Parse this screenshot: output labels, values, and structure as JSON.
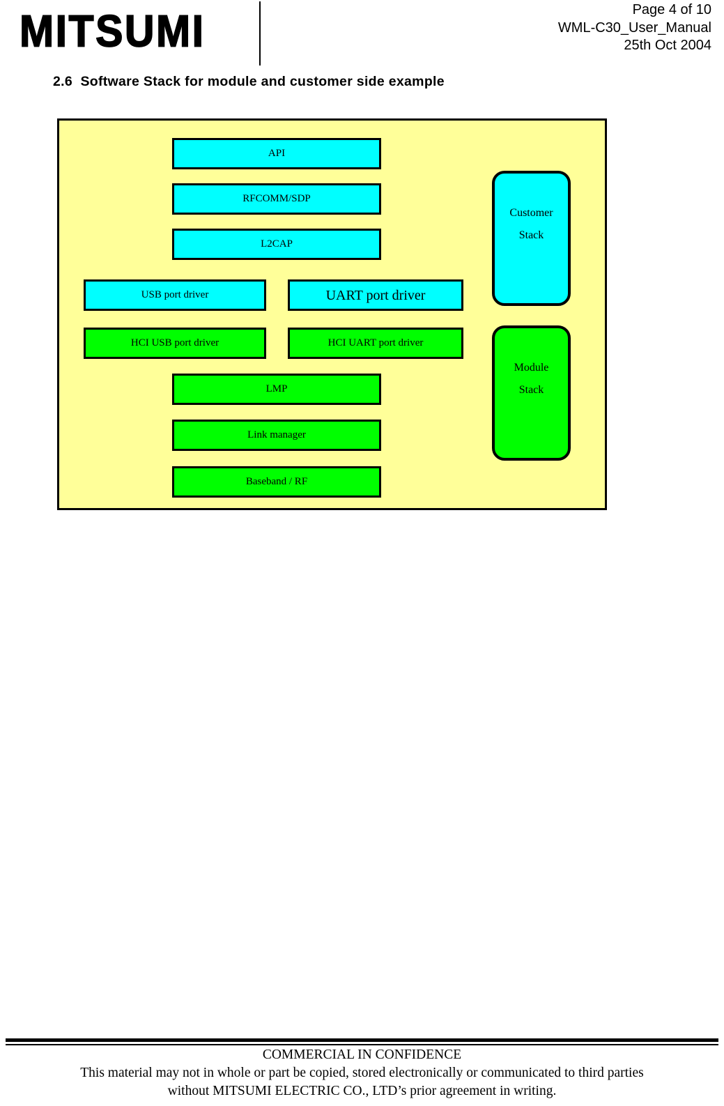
{
  "header": {
    "logo_text": "MITSUMI",
    "page_label": "Page 4 of 10",
    "document_name": "WML-C30_User_Manual",
    "document_date": "25th Oct 2004"
  },
  "heading": {
    "number": "2.6",
    "text": "Software Stack for module and customer side example",
    "full": "2.6  Software Stack for module and customer side example"
  },
  "colors": {
    "background": "#ffff99",
    "customer_stack": "#00ffff",
    "module_stack": "#00ff00",
    "border": "#000000"
  },
  "diagram": {
    "nodes": [
      {
        "id": "api",
        "label": "API",
        "fill": "cyan",
        "column": "center"
      },
      {
        "id": "rfcomm-sdp",
        "label": "RFCOMM/SDP",
        "fill": "cyan",
        "column": "center"
      },
      {
        "id": "l2cap",
        "label": "L2CAP",
        "fill": "cyan",
        "column": "center"
      },
      {
        "id": "usb-port-driver",
        "label": "USB port driver",
        "fill": "cyan",
        "column": "left"
      },
      {
        "id": "uart-port-driver",
        "label": "UART port driver",
        "fill": "cyan",
        "column": "right"
      },
      {
        "id": "hci-usb-port-driver",
        "label": "HCI USB port driver",
        "fill": "green",
        "column": "left"
      },
      {
        "id": "hci-uart-port-driver",
        "label": "HCI UART port driver",
        "fill": "green",
        "column": "right"
      },
      {
        "id": "lmp",
        "label": "LMP",
        "fill": "green",
        "column": "center"
      },
      {
        "id": "link-manager",
        "label": "Link manager",
        "fill": "green",
        "column": "center"
      },
      {
        "id": "baseband-rf",
        "label": "Baseband / RF",
        "fill": "green",
        "column": "center"
      }
    ],
    "legend": [
      {
        "id": "customer-stack",
        "line1": "Customer",
        "line2": "Stack",
        "fill": "cyan"
      },
      {
        "id": "module-stack",
        "line1": "Module",
        "line2": "Stack",
        "fill": "green"
      }
    ]
  },
  "footer": {
    "line1": "COMMERCIAL IN CONFIDENCE",
    "line2": "This material may not in whole or part be copied, stored electronically or communicated to third parties",
    "line3": "without MITSUMI ELECTRIC CO., LTD’s prior agreement in writing."
  }
}
